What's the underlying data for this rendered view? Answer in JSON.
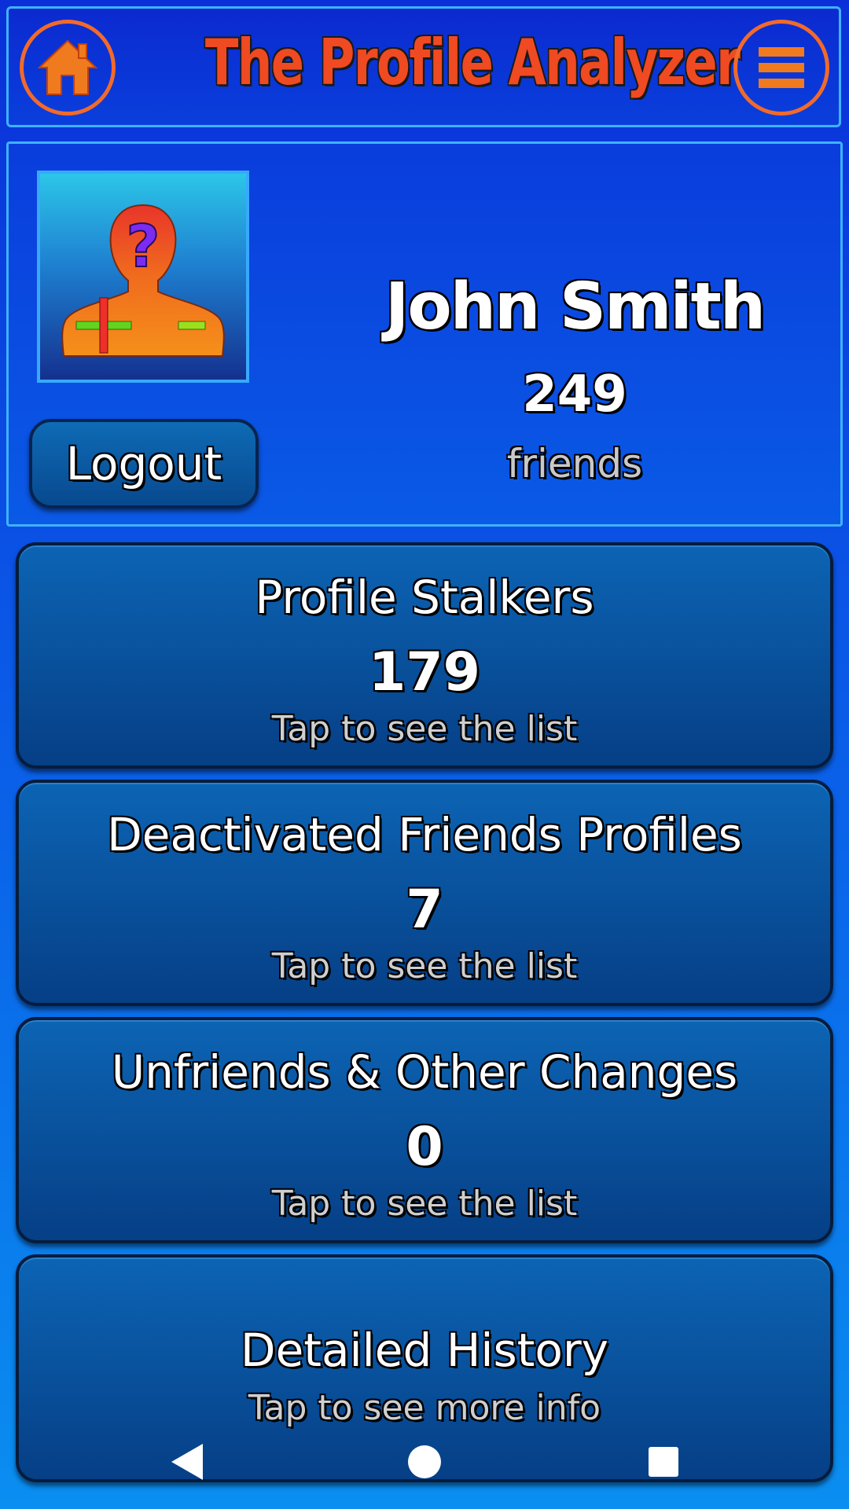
{
  "app": {
    "title": "The Profile Analyzer",
    "accent_color": "#f26a2a",
    "title_color": "#ef4a22"
  },
  "header": {
    "home_icon": "home-icon",
    "menu_icon": "hamburger-menu-icon"
  },
  "profile": {
    "avatar_icon": "unknown-person-avatar-icon",
    "name": "John Smith",
    "friend_count": "249",
    "friend_label": "friends",
    "logout_label": "Logout"
  },
  "cards": [
    {
      "title": "Profile Stalkers",
      "count": "179",
      "subtitle": "Tap to see the list"
    },
    {
      "title": "Deactivated Friends Profiles",
      "count": "7",
      "subtitle": "Tap to see the list"
    },
    {
      "title": "Unfriends & Other Changes",
      "count": "0",
      "subtitle": "Tap to see the list"
    },
    {
      "title": "Detailed History",
      "subtitle": "Tap to see more info"
    }
  ],
  "system_nav": {
    "back_icon": "back-triangle-icon",
    "home_icon": "home-circle-icon",
    "recents_icon": "recents-square-icon"
  }
}
